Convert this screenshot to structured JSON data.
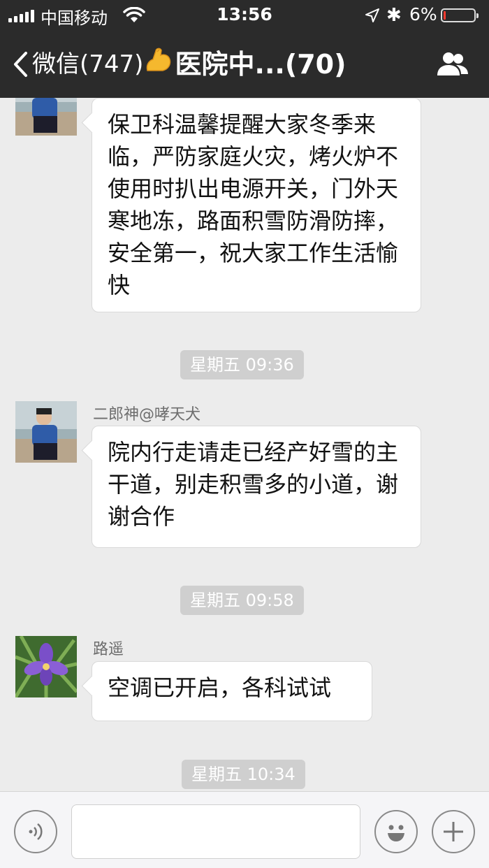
{
  "status_bar": {
    "carrier": "中国移动",
    "time": "13:56",
    "battery_percent": "6%",
    "battery_level": 0.06,
    "battery_color": "#ff3b30"
  },
  "nav": {
    "back_label": "微信(747)",
    "title": "医院中...(70)",
    "title_emoji": "flexed-biceps-icon",
    "right_icon": "group-members-icon"
  },
  "messages": [
    {
      "type": "text",
      "sender": "",
      "avatar": "person-by-sea-avatar",
      "text": "保卫科温馨提醒大家冬季来临，严防家庭火灾，烤火炉不使用时扒出电源开关，门外天寒地冻，路面积雪防滑防摔，安全第一，祝大家工作生活愉快"
    },
    {
      "type": "time",
      "text": "星期五 09:36"
    },
    {
      "type": "text",
      "sender": "二郎神@哮天犬",
      "avatar": "person-by-sea-avatar",
      "text": "院内行走请走已经产好雪的主干道，别走积雪多的小道，谢谢合作"
    },
    {
      "type": "time",
      "text": "星期五 09:58"
    },
    {
      "type": "text",
      "sender": "路遥",
      "avatar": "purple-flower-avatar",
      "text": "空调已开启，各科试试"
    },
    {
      "type": "time",
      "text": "星期五 10:34"
    }
  ],
  "input_bar": {
    "voice_icon": "voice-input-icon",
    "emoji_icon": "smiley-face-icon",
    "plus_icon": "plus-icon",
    "text_value": ""
  },
  "colors": {
    "nav_background": "#2b2b2b",
    "chat_background": "#ececec",
    "timestamp_background": "#cfcfcf"
  }
}
